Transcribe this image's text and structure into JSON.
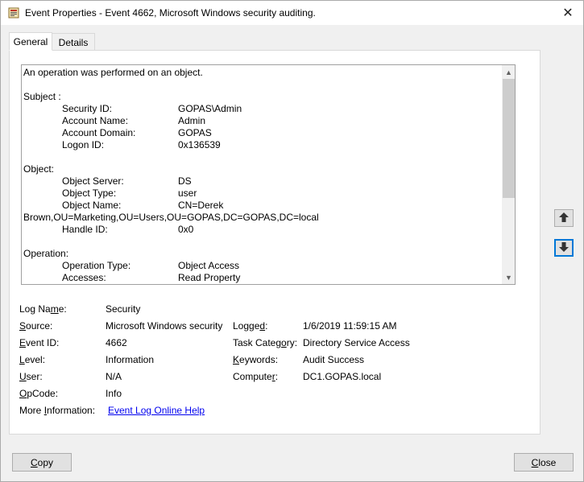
{
  "window": {
    "title": "Event Properties - Event 4662, Microsoft Windows security auditing.",
    "close_glyph": "✕"
  },
  "tabs": [
    {
      "label": "General"
    },
    {
      "label": "Details"
    }
  ],
  "description": {
    "lines": [
      {
        "kind": "full",
        "text": "An operation was performed on an object."
      },
      {
        "kind": "blank"
      },
      {
        "kind": "full",
        "text": "Subject :"
      },
      {
        "kind": "kv",
        "key": "Security ID:",
        "value": "GOPAS\\Admin"
      },
      {
        "kind": "kv",
        "key": "Account Name:",
        "value": "Admin"
      },
      {
        "kind": "kv",
        "key": "Account Domain:",
        "value": "GOPAS"
      },
      {
        "kind": "kv",
        "key": "Logon ID:",
        "value": "0x136539"
      },
      {
        "kind": "blank"
      },
      {
        "kind": "full",
        "text": "Object:"
      },
      {
        "kind": "kv",
        "key": "Object Server:",
        "value": "DS"
      },
      {
        "kind": "kv",
        "key": "Object Type:",
        "value": "user"
      },
      {
        "kind": "kv",
        "key": "Object Name:",
        "value": "CN=Derek"
      },
      {
        "kind": "full",
        "text": "Brown,OU=Marketing,OU=Users,OU=GOPAS,DC=GOPAS,DC=local"
      },
      {
        "kind": "kv",
        "key": "Handle ID:",
        "value": "0x0"
      },
      {
        "kind": "blank"
      },
      {
        "kind": "full",
        "text": "Operation:"
      },
      {
        "kind": "kv",
        "key": "Operation Type:",
        "value": "Object Access"
      },
      {
        "kind": "kv",
        "key": "Accesses:",
        "value": "Read Property"
      }
    ]
  },
  "properties": {
    "log_name_label": "Log Name:",
    "log_name_pre": "Log Na",
    "log_name_acc": "m",
    "log_name_post": "e:",
    "log_name": "Security",
    "source_pre": "",
    "source_acc": "S",
    "source_post": "ource:",
    "source": "Microsoft Windows security",
    "logged_pre": "Logge",
    "logged_acc": "d",
    "logged_post": ":",
    "logged": "1/6/2019 11:59:15 AM",
    "event_id_pre": "",
    "event_id_acc": "E",
    "event_id_post": "vent ID:",
    "event_id": "4662",
    "task_category_pre": "Task Categ",
    "task_category_acc": "o",
    "task_category_post": "ry:",
    "task_category": "Directory Service Access",
    "level_pre": "",
    "level_acc": "L",
    "level_post": "evel:",
    "level": "Information",
    "keywords_pre": "",
    "keywords_acc": "K",
    "keywords_post": "eywords:",
    "keywords": "Audit Success",
    "user_pre": "",
    "user_acc": "U",
    "user_post": "ser:",
    "user": "N/A",
    "computer_pre": "Compute",
    "computer_acc": "r",
    "computer_post": ":",
    "computer": "DC1.GOPAS.local",
    "opcode_pre": "",
    "opcode_acc": "O",
    "opcode_post": "pCode:",
    "opcode": "Info",
    "more_info_pre": "More ",
    "more_info_acc": "I",
    "more_info_post": "nformation:",
    "more_info_link": "Event Log Online Help"
  },
  "buttons": {
    "copy_pre": "",
    "copy_acc": "C",
    "copy_post": "opy",
    "close_pre": "",
    "close_acc": "C",
    "close_post": "lose"
  },
  "icons": {
    "title_icon": "event-viewer-icon",
    "prev": "arrow-up-icon",
    "next": "arrow-down-icon"
  }
}
